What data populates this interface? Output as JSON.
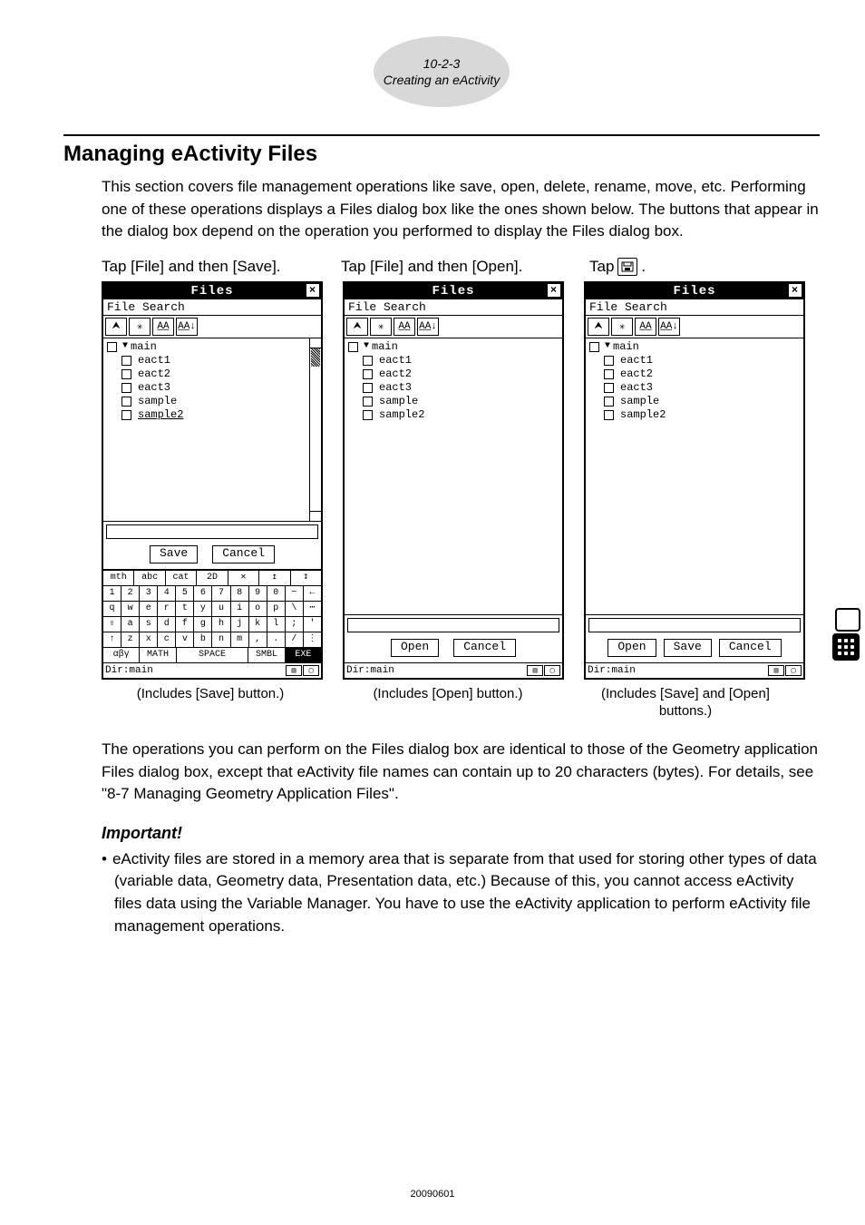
{
  "header": {
    "section_number": "10-2-3",
    "section_title": "Creating an eActivity"
  },
  "title": "Managing eActivity Files",
  "intro": "This section covers file management operations like save, open, delete, rename, move, etc. Performing one of these operations displays a Files dialog box like the ones shown below. The buttons that appear in the dialog box depend on the operation you performed to display the Files dialog box.",
  "captions": {
    "c1": "Tap [File] and then [Save].",
    "c2": "Tap [File] and then [Open].",
    "c3_prefix": "Tap ",
    "c3_suffix": "."
  },
  "dialog": {
    "title": "Files",
    "menu": "File Search",
    "folder": "main",
    "files": [
      "eact1",
      "eact2",
      "eact3",
      "sample",
      "sample2"
    ],
    "save": "Save",
    "open": "Open",
    "cancel": "Cancel",
    "status": "Dir:main"
  },
  "keyboard": {
    "tabs": [
      "mth",
      "abc",
      "cat",
      "2D"
    ],
    "row1": [
      "1",
      "2",
      "3",
      "4",
      "5",
      "6",
      "7",
      "8",
      "9",
      "0",
      "−",
      "←"
    ],
    "row2": [
      "q",
      "w",
      "e",
      "r",
      "t",
      "y",
      "u",
      "i",
      "o",
      "p",
      "\\",
      "⋯"
    ],
    "row3": [
      "⇪",
      "a",
      "s",
      "d",
      "f",
      "g",
      "h",
      "j",
      "k",
      "l",
      ";",
      "'"
    ],
    "row4": [
      "↑",
      "z",
      "x",
      "c",
      "v",
      "b",
      "n",
      "m",
      ",",
      ".",
      "/",
      "⋮"
    ],
    "row5": [
      "αβγ",
      "MATH",
      "SPACE",
      "SMBL",
      "EXE"
    ]
  },
  "subcaptions": {
    "s1": "(Includes [Save] button.)",
    "s2": "(Includes [Open] button.)",
    "s3": "(Includes [Save] and [Open] buttons.)"
  },
  "body_after": "The operations you can perform on the Files dialog box are identical to those of the Geometry application Files dialog box, except that eActivity file names can contain up to 20 characters (bytes). For details, see \"8-7 Managing Geometry Application Files\".",
  "important_heading": "Important!",
  "important_bullet": "eActivity files are stored in a memory area that is separate from that used for storing other types of data (variable data, Geometry data, Presentation data, etc.) Because of this, you cannot access eActivity files data using the Variable Manager. You have to use the eActivity application to perform eActivity file management operations.",
  "footer": "20090601"
}
